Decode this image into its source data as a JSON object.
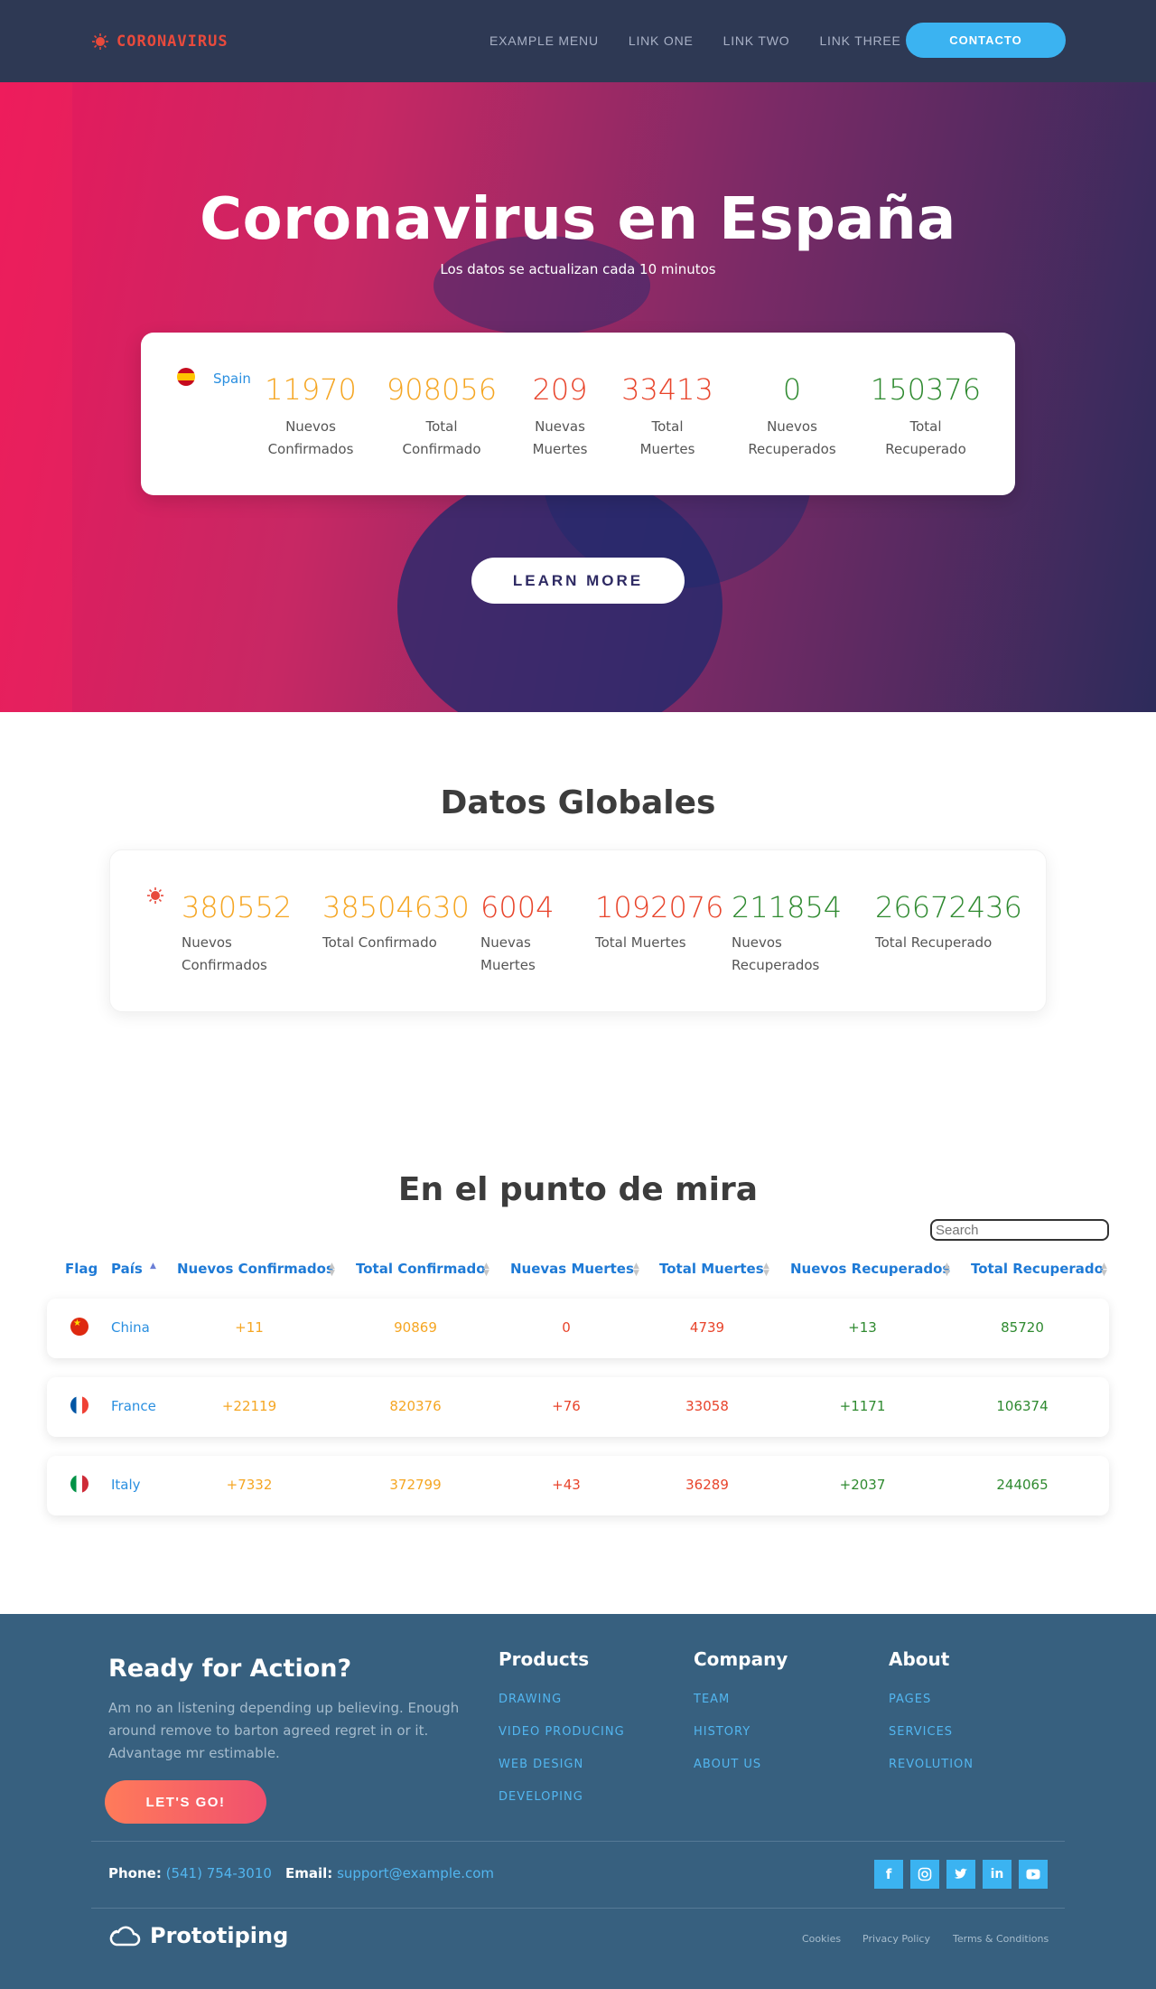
{
  "nav": {
    "logo": "CORONAVIRUS",
    "links": [
      "EXAMPLE MENU",
      "LINK ONE",
      "LINK TWO",
      "LINK THREE"
    ],
    "cta": "CONTACTO"
  },
  "hero": {
    "title": "Coronavirus en España",
    "subtitle": "Los datos se actualizan cada 10 minutos",
    "country": "Spain",
    "stats": [
      {
        "value": "11970",
        "label1": "Nuevos",
        "label2": "Confirmados"
      },
      {
        "value": "908056",
        "label1": "Total",
        "label2": "Confirmado"
      },
      {
        "value": "209",
        "label1": "Nuevas",
        "label2": "Muertes"
      },
      {
        "value": "33413",
        "label1": "Total",
        "label2": "Muertes"
      },
      {
        "value": "0",
        "label1": "Nuevos",
        "label2": "Recuperados"
      },
      {
        "value": "150376",
        "label1": "Total",
        "label2": "Recuperado"
      }
    ],
    "button": "LEARN MORE"
  },
  "global": {
    "title": "Datos Globales",
    "stats": [
      {
        "value": "380552",
        "label1": "Nuevos",
        "label2": "Confirmados"
      },
      {
        "value": "38504630",
        "label1": "Total Confirmado",
        "label2": ""
      },
      {
        "value": "6004",
        "label1": "Nuevas",
        "label2": "Muertes"
      },
      {
        "value": "1092076",
        "label1": "Total Muertes",
        "label2": ""
      },
      {
        "value": "211854",
        "label1": "Nuevos",
        "label2": "Recuperados"
      },
      {
        "value": "26672436",
        "label1": "Total Recuperado",
        "label2": ""
      }
    ]
  },
  "focus": {
    "title": "En el punto de mira",
    "search_placeholder": "Search",
    "columns": [
      "Flag",
      "País",
      "Nuevos Confirmados",
      "Total Confirmado",
      "Nuevas Muertes",
      "Total Muertes",
      "Nuevos Recuperados",
      "Total Recuperado"
    ],
    "rows": [
      {
        "country": "China",
        "new_confirmed": "+11",
        "total_confirmed": "90869",
        "new_deaths": "0",
        "total_deaths": "4739",
        "new_recovered": "+13",
        "total_recovered": "85720"
      },
      {
        "country": "France",
        "new_confirmed": "+22119",
        "total_confirmed": "820376",
        "new_deaths": "+76",
        "total_deaths": "33058",
        "new_recovered": "+1171",
        "total_recovered": "106374"
      },
      {
        "country": "Italy",
        "new_confirmed": "+7332",
        "total_confirmed": "372799",
        "new_deaths": "+43",
        "total_deaths": "36289",
        "new_recovered": "+2037",
        "total_recovered": "244065"
      }
    ]
  },
  "footer": {
    "title": "Ready for Action?",
    "text": "Am no an listening depending up believing. Enough around remove to barton agreed regret in or it. Advantage mr estimable.",
    "button": "LET'S GO!",
    "products": {
      "title": "Products",
      "links": [
        "DRAWING",
        "VIDEO PRODUCING",
        "WEB DESIGN",
        "DEVELOPING"
      ]
    },
    "company": {
      "title": "Company",
      "links": [
        "TEAM",
        "HISTORY",
        "ABOUT US"
      ]
    },
    "about": {
      "title": "About",
      "links": [
        "PAGES",
        "SERVICES",
        "REVOLUTION"
      ]
    },
    "phone_label": "Phone:",
    "phone": "(541) 754-3010",
    "email_label": "Email:",
    "email": "support@example.com",
    "social": [
      "facebook-icon",
      "instagram-icon",
      "twitter-icon",
      "linkedin-icon",
      "youtube-icon"
    ],
    "brand": "Prototiping",
    "legal": [
      "Cookies",
      "Privacy Policy",
      "Terms & Conditions"
    ]
  },
  "colors": {
    "nav_bg": "#2e3954",
    "accent_blue": "#3bb3f1",
    "orange": "#f5a623",
    "red": "#e8442b",
    "green": "#2f8a30",
    "footer_bg": "#37607f"
  }
}
